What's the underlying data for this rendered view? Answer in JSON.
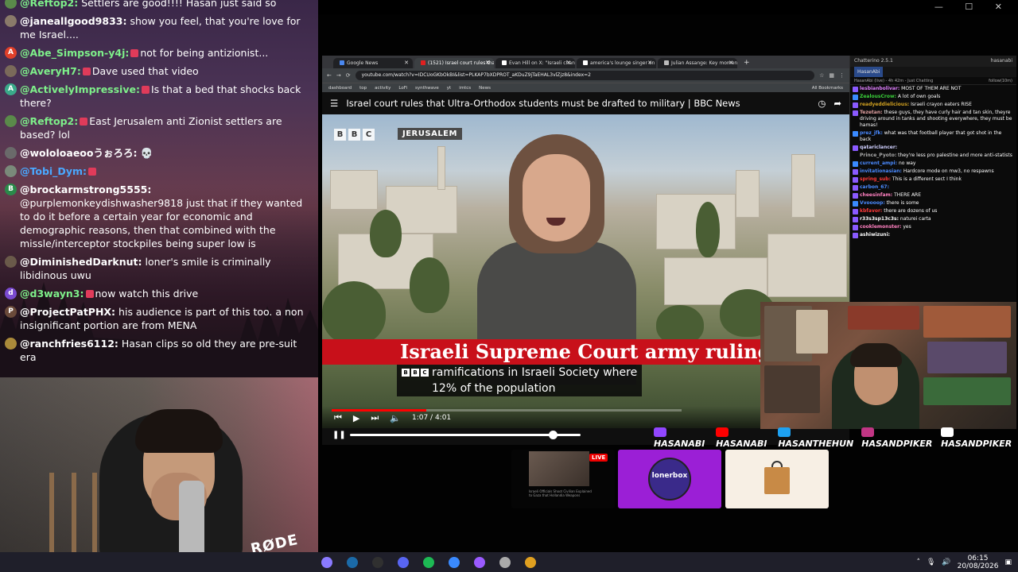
{
  "left_chat": {
    "messages": [
      {
        "user": "@Reftop2:",
        "text": "Settlers are good!!!! Hasan just said so",
        "avatar_color": "#5a8a4a",
        "avatar_letter": "",
        "user_color": "#7ef08a",
        "badge": false
      },
      {
        "user": "@janeallgood9833:",
        "text": "show you feel, that you're love for me Israel....",
        "avatar_color": "#8a7a6a",
        "avatar_letter": "",
        "user_color": "#ffffff",
        "badge": false
      },
      {
        "user": "@Abe_Simpson-y4j:",
        "text": "not for being antizionist...",
        "avatar_color": "#e0402a",
        "avatar_letter": "A",
        "user_color": "#7ef08a",
        "badge": true
      },
      {
        "user": "@AveryH7:",
        "text": "Dave used that video",
        "avatar_color": "#7a6a5a",
        "avatar_letter": "",
        "user_color": "#7ef08a",
        "badge": true
      },
      {
        "user": "@ActivelyImpressive:",
        "text": "Is that a bed that shocks back there?",
        "avatar_color": "#3aaa8a",
        "avatar_letter": "A",
        "user_color": "#7ef08a",
        "badge": true
      },
      {
        "user": "@Reftop2:",
        "text": "East Jerusalem anti Zionist settlers are based? lol",
        "avatar_color": "#5a8a4a",
        "avatar_letter": "",
        "user_color": "#7ef08a",
        "badge": true
      },
      {
        "user": "@wololoaeooうぉろろ:",
        "text": "💀",
        "avatar_color": "#6a6a6a",
        "avatar_letter": "",
        "user_color": "#ffffff",
        "badge": false
      },
      {
        "user": "@Tobi_Dym:",
        "text": "",
        "avatar_color": "#7a8a7a",
        "avatar_letter": "",
        "user_color": "#4aa8ff",
        "badge": true
      },
      {
        "user": "@brockarmstrong5555:",
        "text": "@purplemonkeydishwasher9818 just that if they wanted to do it before a certain year for economic and demographic reasons, then that combined with the missle/interceptor stockpiles being super low is",
        "avatar_color": "#2a8a4a",
        "avatar_letter": "B",
        "user_color": "#ffffff",
        "badge": false
      },
      {
        "user": "@DiminishedDarknut:",
        "text": "loner's smile is criminally libidinous uwu",
        "avatar_color": "#6a5a4a",
        "avatar_letter": "",
        "user_color": "#ffffff",
        "badge": false
      },
      {
        "user": "@d3wayn3:",
        "text": "now watch this drive",
        "avatar_color": "#7a4ad0",
        "avatar_letter": "d",
        "user_color": "#7ef08a",
        "badge": true
      },
      {
        "user": "@ProjectPatPHX:",
        "text": "his audience is part of this too. a non insignificant portion are from MENA",
        "avatar_color": "#6a4a3a",
        "avatar_letter": "P",
        "user_color": "#ffffff",
        "badge": false
      },
      {
        "user": "@ranchfries6112:",
        "text": "Hasan clips so old they are pre-suit era",
        "avatar_color": "#aa8a3a",
        "avatar_letter": "",
        "user_color": "#ffffff",
        "badge": false
      }
    ]
  },
  "browser": {
    "tabs": [
      {
        "label": "Google News",
        "color": "#4a88f0",
        "active": false
      },
      {
        "label": "(1521) Israel court rules tha...",
        "color": "#e02020",
        "active": true
      },
      {
        "label": "Evan Hill on X: \"Israeli channel...",
        "color": "#ffffff",
        "active": false
      },
      {
        "label": "america's lounge singer on X...",
        "color": "#ffffff",
        "active": false
      },
      {
        "label": "Julian Assange: Key moments i...",
        "color": "#bbbbbb",
        "active": false
      }
    ],
    "url": "youtube.com/watch?v=IDCUoGKbOkBI&list=PLKAP7bXDPROT_aKDuZ9jTaEHAL3vlZjz8&index=2",
    "bookmarks": [
      "dashboard",
      "top",
      "activity",
      "LoFi",
      "synthwave",
      "yt",
      "imtcs",
      "News"
    ],
    "all_bookmarks": "All Bookmarks",
    "video_title": "Israel court rules that Ultra-Orthodox students must be drafted to military | BBC News"
  },
  "video": {
    "bbc_letters": [
      "B",
      "B",
      "C"
    ],
    "location_tag": "JERUSALEM",
    "lower_third": "Israeli Supreme Court army ruling",
    "caption_line1": "ramifications in Israeli Society where",
    "caption_line2": "12% of the population",
    "time": "1:07 / 4:01",
    "progress": 0.27
  },
  "chatterino": {
    "app_title": "Chatterino 2.5.1",
    "account": "hasanabi",
    "tab_name": "HasanAbi",
    "status_left": "HasanAbi (live) - 4h 42m - Just Chatting",
    "status_right": "follow(10m)",
    "messages": [
      {
        "user": "lesbianbolivar:",
        "text": "MOST OF THEM ARE NOT",
        "color": "#e080ff",
        "badge": "#8a5aff"
      },
      {
        "user": "ZealousCrow:",
        "text": "A lot of own goals",
        "color": "#3ad03a",
        "badge": "#3a8aff"
      },
      {
        "user": "readyeddielicious:",
        "text": "Israeli crayon eaters RISE",
        "color": "#d0a020",
        "badge": "#8a5aff"
      },
      {
        "user": "Tezetan:",
        "text": "these guys, they have curly hair and tan skin, theyre driving around in tanks and shooting everywhere, they must be hamas!",
        "color": "#e0a0a0",
        "badge": "#8a5aff"
      },
      {
        "user": "prez_jfk:",
        "text": "what was that football player that got shot in the back",
        "color": "#4a8aff",
        "badge": "#3a8aff"
      },
      {
        "user": "qatariclancer:",
        "text": "",
        "color": "#d0d0ff",
        "badge": "#8a5aff"
      },
      {
        "user": "Prince_Pyoto:",
        "text": "they're less pro palestine and more anti-statists",
        "color": "#aaaaaa",
        "badge": ""
      },
      {
        "user": "current_ampi:",
        "text": "no way",
        "color": "#4a8aff",
        "badge": "#3a8aff"
      },
      {
        "user": "invitationasian:",
        "text": "Hardcore mode on mw3, no respawns",
        "color": "#4a8aff",
        "badge": "#8a5aff"
      },
      {
        "user": "spring_sub:",
        "text": "This is a different sect I think",
        "color": "#ff3a3a",
        "badge": "#8a5aff"
      },
      {
        "user": "carbon_67:",
        "text": "",
        "color": "#4a8aff",
        "badge": "#8a5aff"
      },
      {
        "user": "cheesinfam:",
        "text": "THERE ARE",
        "color": "#ff80c0",
        "badge": "#8a5aff"
      },
      {
        "user": "Vvoooop:",
        "text": "there is some",
        "color": "#4a8aff",
        "badge": "#3a8aff"
      },
      {
        "user": "kbfavor:",
        "text": "there are dozens of us",
        "color": "#ff3a3a",
        "badge": "#8a5aff"
      },
      {
        "user": "r33s3sp13c3s:",
        "text": "naturei carta",
        "color": "#ffffff",
        "badge": "#8a5aff"
      },
      {
        "user": "cooklemonster:",
        "text": "yes",
        "color": "#ff80c0",
        "badge": "#8a5aff"
      },
      {
        "user": "ashiwizuni:",
        "text": "",
        "color": "#ffffff",
        "badge": "#8a5aff"
      }
    ]
  },
  "socials": [
    {
      "handle": "HASANABI",
      "color": "#9146ff"
    },
    {
      "handle": "HASANABI",
      "color": "#ff0000"
    },
    {
      "handle": "HASANTHEHUN",
      "color": "#1da1f2"
    },
    {
      "handle": "HASANDPIKER",
      "color": "#c13584"
    },
    {
      "handle": "HASANDPIKER",
      "color": "#ffffff"
    }
  ],
  "tiles": {
    "live_label": "LIVE",
    "video_text": "Israeli Officials Shoot Civilian Explained to Gaza that Hollandia Weapons",
    "lonerbox_label": "lonerbox"
  },
  "overlay": {
    "rode_label": "RØDE",
    "player_progress": 0.88
  },
  "taskbar": {
    "icons": [
      {
        "name": "app-icon",
        "color": "#8a7aff"
      },
      {
        "name": "steam-icon",
        "color": "#1b6aa8"
      },
      {
        "name": "obs-icon",
        "color": "#303030"
      },
      {
        "name": "discord-icon",
        "color": "#5865f2"
      },
      {
        "name": "spotify-icon",
        "color": "#1db954"
      },
      {
        "name": "app2-icon",
        "color": "#3a8aff"
      },
      {
        "name": "app3-icon",
        "color": "#9a5aff"
      },
      {
        "name": "app4-icon",
        "color": "#aaaaaa"
      },
      {
        "name": "chrome-icon",
        "color": "#e0a020"
      }
    ],
    "time": "06:15",
    "date": "20/08/2026"
  }
}
